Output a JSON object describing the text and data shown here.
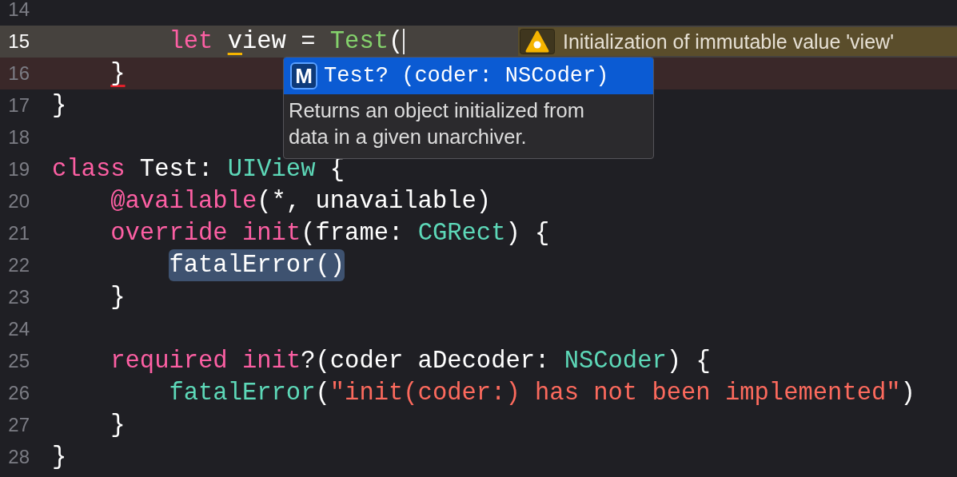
{
  "editor": {
    "lines": [
      {
        "number": "14",
        "current_line": false,
        "error_line": false,
        "cursor": false
      },
      {
        "number": "15",
        "current_line": true,
        "error_line": false,
        "cursor": true,
        "tokens": [
          {
            "kind": "keyword",
            "text": "        let"
          },
          {
            "kind": "plain",
            "text": " v",
            "warning_squiggle": true
          },
          {
            "kind": "plain",
            "text": "iew = "
          },
          {
            "kind": "class",
            "text": "Test"
          },
          {
            "kind": "plain",
            "text": "("
          }
        ],
        "warning": {
          "message": "Initialization of immutable value 'view'"
        }
      },
      {
        "number": "16",
        "current_line": false,
        "error_line": true,
        "cursor": false,
        "tokens": [
          {
            "kind": "plain",
            "text": "    }",
            "error_squiggle": true
          }
        ]
      },
      {
        "number": "17",
        "current_line": false,
        "error_line": false,
        "cursor": false,
        "tokens": [
          {
            "kind": "plain",
            "text": "}"
          }
        ]
      },
      {
        "number": "18",
        "current_line": false,
        "error_line": false,
        "cursor": false
      },
      {
        "number": "19",
        "current_line": false,
        "error_line": false,
        "cursor": false,
        "tokens": [
          {
            "kind": "keyword",
            "text": "class"
          },
          {
            "kind": "plain",
            "text": " Test: "
          },
          {
            "kind": "type",
            "text": "UIView"
          },
          {
            "kind": "plain",
            "text": " {"
          }
        ]
      },
      {
        "number": "20",
        "current_line": false,
        "error_line": false,
        "cursor": false,
        "tokens": [
          {
            "kind": "keyword",
            "text": "    @available"
          },
          {
            "kind": "plain",
            "text": "(*, unavailable)"
          }
        ]
      },
      {
        "number": "21",
        "current_line": false,
        "error_line": false,
        "cursor": false,
        "tokens": [
          {
            "kind": "keyword",
            "text": "    override"
          },
          {
            "kind": "keyword",
            "text": " init"
          },
          {
            "kind": "plain",
            "text": "(frame: "
          },
          {
            "kind": "type",
            "text": "CGRect"
          },
          {
            "kind": "plain",
            "text": ") {"
          }
        ]
      },
      {
        "number": "22",
        "current_line": false,
        "error_line": false,
        "cursor": false,
        "tokens": [
          {
            "kind": "plain",
            "text": "        fatalError()",
            "selected": true
          }
        ]
      },
      {
        "number": "23",
        "current_line": false,
        "error_line": false,
        "cursor": false,
        "tokens": [
          {
            "kind": "plain",
            "text": "    }"
          }
        ]
      },
      {
        "number": "24",
        "current_line": false,
        "error_line": false,
        "cursor": false
      },
      {
        "number": "25",
        "current_line": false,
        "error_line": false,
        "cursor": false,
        "tokens": [
          {
            "kind": "keyword",
            "text": "    required"
          },
          {
            "kind": "keyword",
            "text": " init"
          },
          {
            "kind": "plain",
            "text": "?(coder aDecoder: "
          },
          {
            "kind": "type",
            "text": "NSCoder"
          },
          {
            "kind": "plain",
            "text": ") {"
          }
        ]
      },
      {
        "number": "26",
        "current_line": false,
        "error_line": false,
        "cursor": false,
        "tokens": [
          {
            "kind": "type",
            "text": "        fatalError"
          },
          {
            "kind": "plain",
            "text": "("
          },
          {
            "kind": "string",
            "text": "\"init(coder:) has not been implemented\""
          },
          {
            "kind": "plain",
            "text": ")"
          }
        ]
      },
      {
        "number": "27",
        "current_line": false,
        "error_line": false,
        "cursor": false,
        "tokens": [
          {
            "kind": "plain",
            "text": "    }"
          }
        ]
      },
      {
        "number": "28",
        "current_line": false,
        "error_line": false,
        "cursor": false,
        "tokens": [
          {
            "kind": "plain",
            "text": "}"
          }
        ]
      }
    ],
    "completion": {
      "items": [
        {
          "badge": "M",
          "signature": "Test? (coder: NSCoder)",
          "selected": true
        }
      ],
      "description": "Returns an object initialized from data in a given unarchiver."
    }
  }
}
